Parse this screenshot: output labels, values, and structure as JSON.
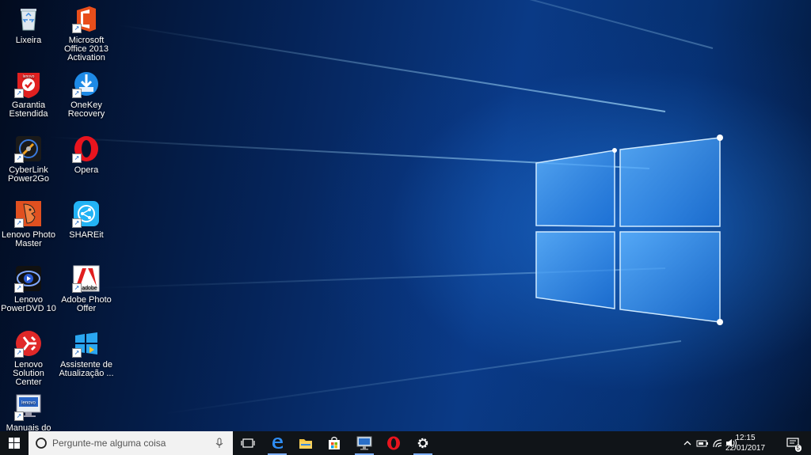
{
  "desktop": {
    "icons": [
      {
        "label": "Lixeira",
        "icon": "recycle-bin-icon"
      },
      {
        "label": "Microsoft Office 2013 Activation",
        "icon": "office-icon"
      },
      {
        "label": "Garantia Estendida",
        "icon": "lenovo-warranty-icon"
      },
      {
        "label": "OneKey Recovery",
        "icon": "onekey-recovery-icon"
      },
      {
        "label": "CyberLink Power2Go",
        "icon": "power2go-icon"
      },
      {
        "label": "Opera",
        "icon": "opera-icon"
      },
      {
        "label": "Lenovo Photo Master",
        "icon": "photo-master-icon"
      },
      {
        "label": "SHAREit",
        "icon": "shareit-icon"
      },
      {
        "label": "Lenovo PowerDVD 10",
        "icon": "powerdvd-icon"
      },
      {
        "label": "Adobe Photo Offer",
        "icon": "adobe-icon"
      },
      {
        "label": "Lenovo Solution Center",
        "icon": "solution-center-icon"
      },
      {
        "label": "Assistente de Atualização ...",
        "icon": "windows-update-icon"
      },
      {
        "label": "Manuais do",
        "icon": "lenovo-manuals-icon"
      }
    ],
    "lenovo_logo_text": "lenovo",
    "adobe_logo_text": "adobe"
  },
  "taskbar": {
    "search_placeholder": "Pergunte-me alguma coisa",
    "pinned": [
      "task-view",
      "edge",
      "file-explorer",
      "store",
      "remote-desktop",
      "opera",
      "settings"
    ]
  },
  "tray": {
    "time": "12:15",
    "date": "22/01/2017",
    "notification_count": "5"
  },
  "colors": {
    "taskbar": "#101418",
    "accent": "#0078d7"
  }
}
